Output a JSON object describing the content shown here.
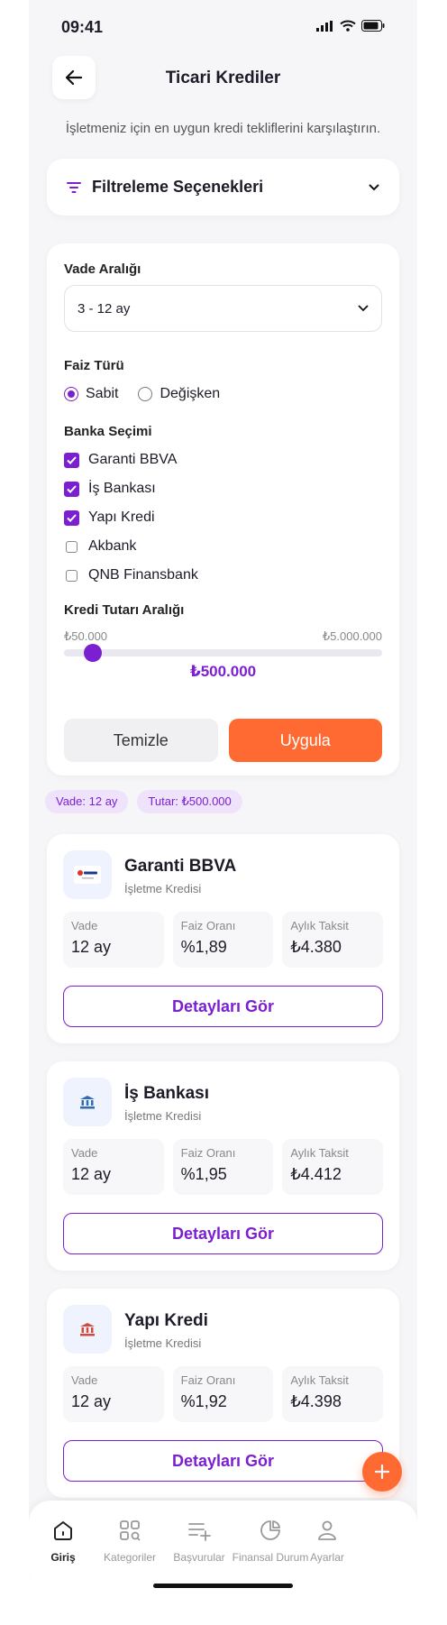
{
  "status": {
    "time": "09:41"
  },
  "header": {
    "title": "Ticari Krediler",
    "subtitle": "İşletmeniz için en uygun kredi tekliflerini karşılaştırın."
  },
  "filter_toggle": {
    "label": "Filtreleme Seçenekleri"
  },
  "filters": {
    "term_label": "Vade Aralığı",
    "term_value": "3 - 12 ay",
    "rate_label": "Faiz Türü",
    "rate_options": [
      "Sabit",
      "Değişken"
    ],
    "rate_selected": "Sabit",
    "bank_label": "Banka Seçimi",
    "banks": [
      {
        "name": "Garanti BBVA",
        "checked": true
      },
      {
        "name": "İş Bankası",
        "checked": true
      },
      {
        "name": "Yapı Kredi",
        "checked": true
      },
      {
        "name": "Akbank",
        "checked": false
      },
      {
        "name": "QNB Finansbank",
        "checked": false
      }
    ],
    "amount_label": "Kredi Tutarı Aralığı",
    "amount_min": "₺50.000",
    "amount_max": "₺5.000.000",
    "amount_value": "₺500.000",
    "slider_position": 0.09,
    "clear_label": "Temizle",
    "apply_label": "Uygula"
  },
  "chips": [
    "Vade: 12 ay",
    "Tutar: ₺500.000"
  ],
  "stat_labels": {
    "term": "Vade",
    "rate": "Faiz Oranı",
    "installment": "Aylık Taksit"
  },
  "loans": [
    {
      "bank": "Garanti BBVA",
      "type": "İşletme Kredisi",
      "term": "12 ay",
      "rate": "%1,89",
      "installment": "₺4.380",
      "button": "Detayları Gör",
      "logo": "garanti-logo"
    },
    {
      "bank": "İş Bankası",
      "type": "İşletme Kredisi",
      "term": "12 ay",
      "rate": "%1,95",
      "installment": "₺4.412",
      "button": "Detayları Gör",
      "logo": "bank-building-icon"
    },
    {
      "bank": "Yapı Kredi",
      "type": "İşletme Kredisi",
      "term": "12 ay",
      "rate": "%1,92",
      "installment": "₺4.398",
      "button": "Detayları Gör",
      "logo": "bank-building-icon"
    }
  ],
  "tabs": [
    {
      "label": "Giriş",
      "icon": "home-icon",
      "active": true
    },
    {
      "label": "Kategoriler",
      "icon": "categories-icon",
      "active": false
    },
    {
      "label": "Başvurular",
      "icon": "add-list-icon",
      "active": false
    },
    {
      "label": "Finansal Durum",
      "icon": "pie-chart-icon",
      "active": false
    },
    {
      "label": "Ayarlar",
      "icon": "user-icon",
      "active": false
    }
  ],
  "colors": {
    "accent": "#7b1fd1",
    "orange": "#ff6a33"
  }
}
